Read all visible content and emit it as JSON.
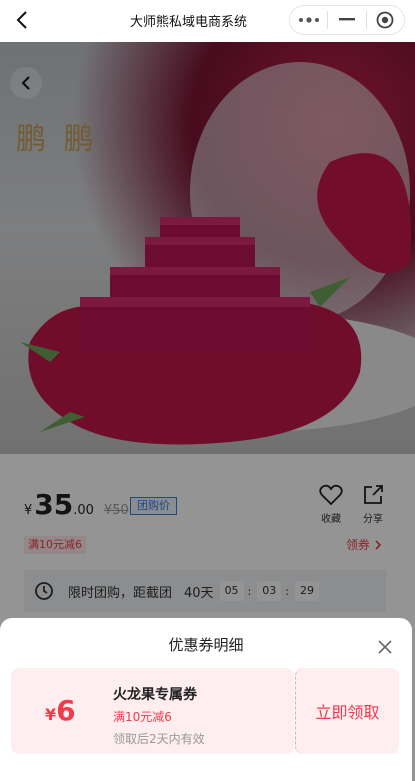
{
  "header": {
    "title": "大师熊私域电商系统"
  },
  "hero": {
    "watermark": "鹏 鹏"
  },
  "product": {
    "currency": "¥",
    "price_int": "35",
    "price_dec": ".00",
    "original_price": "¥50",
    "group_tag": "团购价",
    "actions": {
      "favorite": "收藏",
      "share": "分享"
    },
    "coupon_chip": "满10元减6",
    "get_coupon": "领券",
    "countdown": {
      "label": "限时团购，距截团",
      "days": "40天",
      "hours": "05",
      "minutes": "03",
      "seconds": "29"
    }
  },
  "sheet": {
    "title": "优惠券明细",
    "coupon": {
      "currency": "¥",
      "amount": "6",
      "name": "火龙果专属券",
      "condition": "满10元减6",
      "validity": "领取后2天内有效",
      "claim_label": "立即领取"
    }
  },
  "colors": {
    "accent": "#f03b4b",
    "coupon_bg": "#ffeef0",
    "group_tag": "#3a7bd5"
  }
}
